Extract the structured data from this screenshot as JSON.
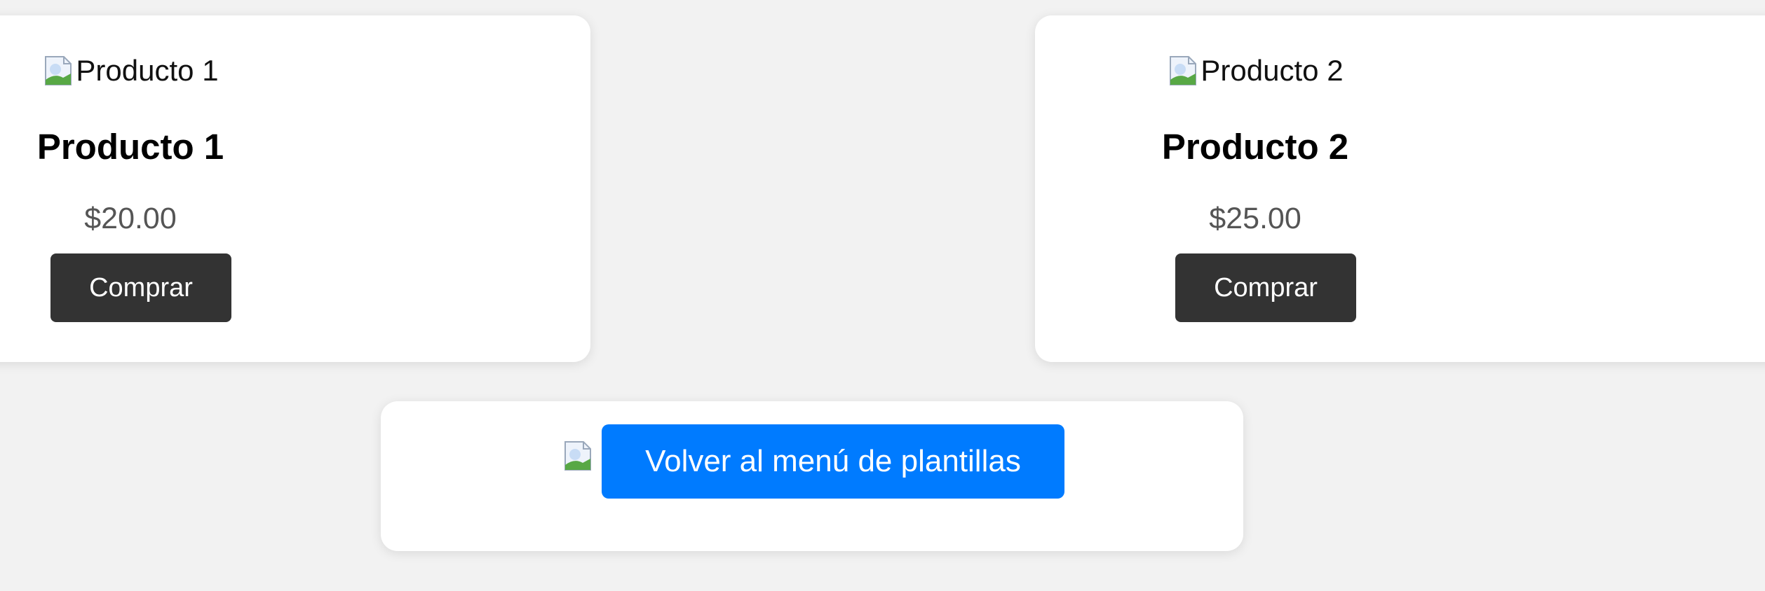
{
  "products": [
    {
      "image_alt": "Producto 1",
      "name": "Producto 1",
      "price": "$20.00",
      "button_label": "Comprar"
    },
    {
      "image_alt": "Producto 2",
      "name": "Producto 2",
      "price": "$25.00",
      "button_label": "Comprar"
    }
  ],
  "footer": {
    "back_button_label": "Volver al menú de plantillas",
    "image_icon": "broken-image-icon"
  },
  "colors": {
    "page_background": "#f2f2f2",
    "card_background": "#ffffff",
    "buy_button": "#333333",
    "back_button": "#007bff",
    "price_text": "#555555"
  }
}
